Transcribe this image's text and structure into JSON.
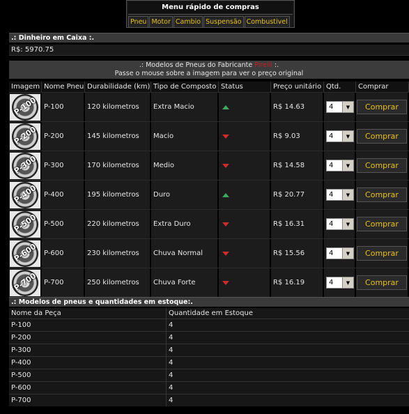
{
  "menu": {
    "title": "Menu rápido de compras",
    "items": [
      "Pneu",
      "Motor",
      "Cambio",
      "Suspensão",
      "Combustivel"
    ]
  },
  "cash": {
    "section_title": ".: Dinheiro em Caixa :.",
    "value": "R$: 5970.75"
  },
  "notice": {
    "line1_prefix": ".: Modelos de Pneus do Fabricante ",
    "brand": "Pirelli",
    "line1_suffix": " :.",
    "line2": "Passe o mouse sobre a imagem para ver o preço original"
  },
  "models_table": {
    "headers": [
      "Imagem",
      "Nome Pneu",
      "Durabilidade (km)",
      "Tipo de Composto",
      "Status",
      "Preço unitário",
      "Qtd.",
      "Comprar"
    ],
    "rows": [
      {
        "img_label": "P-100",
        "name": "P-100",
        "durability": "120 kilometros",
        "compound": "Extra Macio",
        "status": "up",
        "price": "R$ 14.63",
        "qty": "4",
        "buy": "Comprar"
      },
      {
        "img_label": "P-200",
        "name": "P-200",
        "durability": "145 kilometros",
        "compound": "Macio",
        "status": "down",
        "price": "R$ 9.03",
        "qty": "4",
        "buy": "Comprar"
      },
      {
        "img_label": "P-300",
        "name": "P-300",
        "durability": "170 kilometros",
        "compound": "Medio",
        "status": "down",
        "price": "R$ 14.58",
        "qty": "4",
        "buy": "Comprar"
      },
      {
        "img_label": "P-400",
        "name": "P-400",
        "durability": "195 kilometros",
        "compound": "Duro",
        "status": "up",
        "price": "R$ 20.77",
        "qty": "4",
        "buy": "Comprar"
      },
      {
        "img_label": "P-500",
        "name": "P-500",
        "durability": "220 kilometros",
        "compound": "Extra Duro",
        "status": "down",
        "price": "R$ 16.31",
        "qty": "4",
        "buy": "Comprar"
      },
      {
        "img_label": "P-600",
        "name": "P-600",
        "durability": "230 kilometros",
        "compound": "Chuva Normal",
        "status": "down",
        "price": "R$ 15.56",
        "qty": "4",
        "buy": "Comprar"
      },
      {
        "img_label": "P-700",
        "name": "P-700",
        "durability": "250 kilometros",
        "compound": "Chuva Forte",
        "status": "down",
        "price": "R$ 16.19",
        "qty": "4",
        "buy": "Comprar"
      }
    ]
  },
  "stock": {
    "section_title": ".: Modelos de pneus e quantidades em estoque:.",
    "headers": [
      "Nome da Peça",
      "Quantidade em Estoque"
    ],
    "rows": [
      {
        "name": "P-100",
        "qty": "4"
      },
      {
        "name": "P-200",
        "qty": "4"
      },
      {
        "name": "P-300",
        "qty": "4"
      },
      {
        "name": "P-400",
        "qty": "4"
      },
      {
        "name": "P-500",
        "qty": "4"
      },
      {
        "name": "P-600",
        "qty": "4"
      },
      {
        "name": "P-700",
        "qty": "4"
      }
    ]
  },
  "colors": {
    "link": "#e8c11a",
    "status_up": "#3caa5a",
    "status_down": "#d02a2a",
    "brand": "#c02020"
  },
  "icons": {
    "status_up": "triangle-up-icon",
    "status_down": "triangle-down-icon",
    "select_arrow": "chevron-down-icon"
  }
}
